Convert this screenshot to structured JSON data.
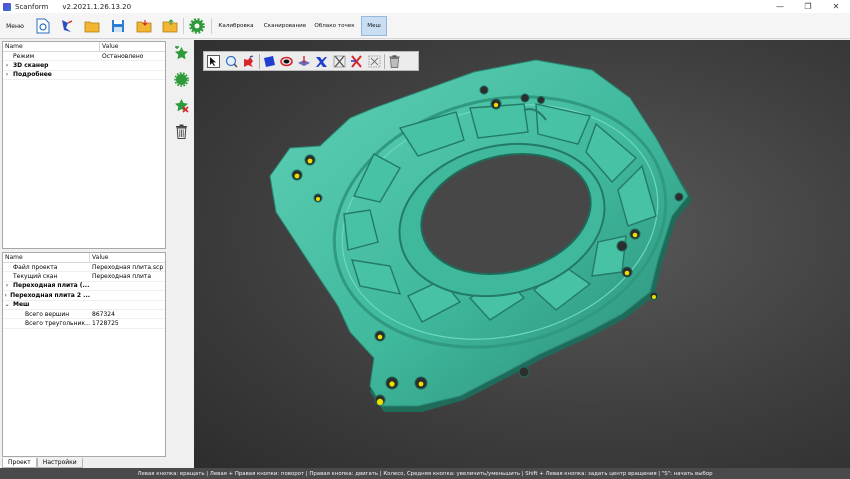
{
  "window": {
    "app_name": "Scanform",
    "version": "v2.2021.1.26.13.20",
    "minimize": "—",
    "maximize": "❐",
    "close": "✕"
  },
  "toolbar": {
    "menu_label": "Меню",
    "tabs": [
      {
        "label": "Калибровка",
        "active": false
      },
      {
        "label": "Сканирование",
        "active": false
      },
      {
        "label": "Облако точек",
        "active": false
      },
      {
        "label": "Меш",
        "active": true
      }
    ]
  },
  "properties_top": {
    "col_name": "Name",
    "col_value": "Value",
    "rows": [
      {
        "name": "Режим",
        "value": "Остановлено",
        "bold": false,
        "expand": ""
      },
      {
        "name": "3D сканер",
        "value": "",
        "bold": true,
        "expand": "›"
      },
      {
        "name": "Подробнее",
        "value": "",
        "bold": true,
        "expand": "›"
      }
    ]
  },
  "properties_bottom": {
    "col_name": "Name",
    "col_value": "Value",
    "rows": [
      {
        "name": "Файл проекта",
        "value": "Переходная плита.scp",
        "bold": false,
        "expand": "",
        "indent": 1
      },
      {
        "name": "Текущий скан",
        "value": "Переходная плита",
        "bold": false,
        "expand": "",
        "indent": 1
      },
      {
        "name": "Переходная плита (...",
        "value": "",
        "bold": true,
        "expand": "›",
        "indent": 0
      },
      {
        "name": "Переходная плита 2 ...",
        "value": "",
        "bold": true,
        "expand": "›",
        "indent": 0
      },
      {
        "name": "Меш",
        "value": "",
        "bold": true,
        "expand": "⌄",
        "indent": 0
      },
      {
        "name": "Всего вершин",
        "value": "867324",
        "bold": false,
        "expand": "",
        "indent": 2
      },
      {
        "name": "Всего треугольник...",
        "value": "1728725",
        "bold": false,
        "expand": "",
        "indent": 2
      }
    ]
  },
  "bottom_tabs": [
    {
      "label": "Проект",
      "active": true
    },
    {
      "label": "Настройки",
      "active": false
    }
  ],
  "status_bar": {
    "text": "Левая кнопка: вращать  |  Левая + Правая кнопки: поворот  |  Правая кнопка: двигать  |  Колесо, Средняя кнопка: увеличить/уменьшить  |  Shift + Левая кнопка: задать центр вращения  |  \"S\": начать выбор"
  },
  "colors": {
    "mesh": "#3fb89c",
    "mesh_dark": "#2a8a74",
    "hole_marker": "#e8e000",
    "active_tab": "#c9def3"
  }
}
